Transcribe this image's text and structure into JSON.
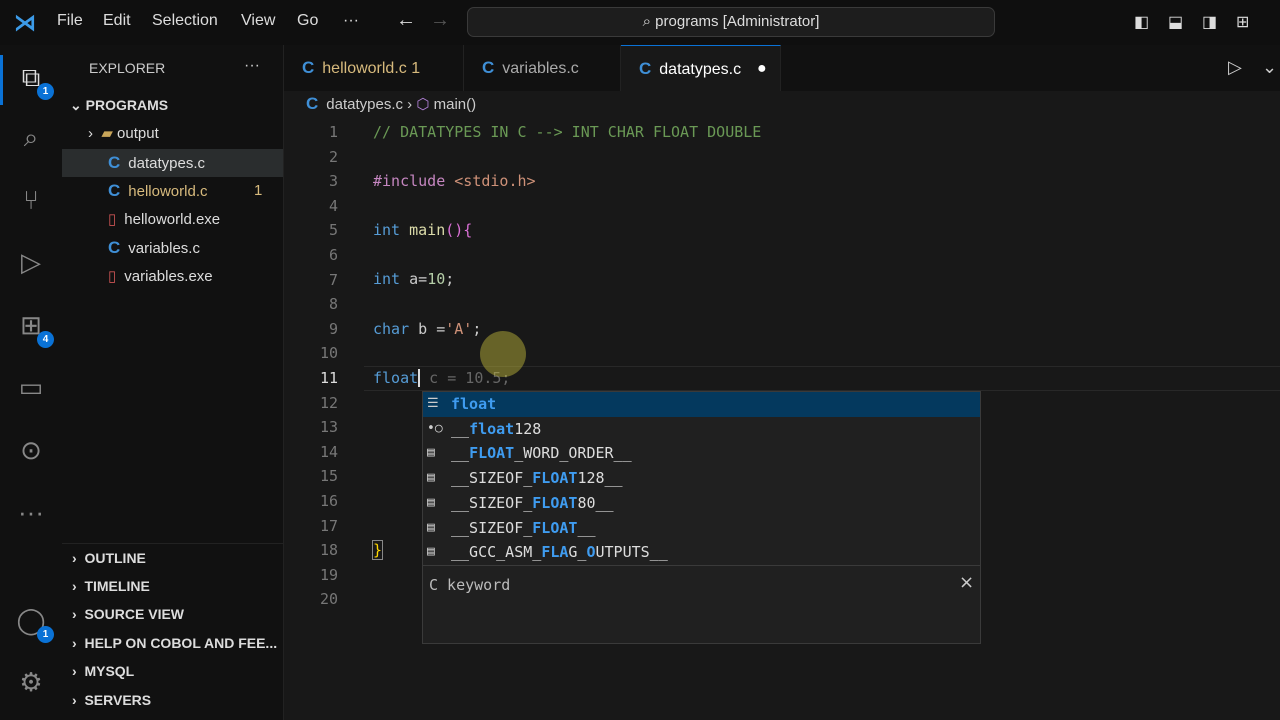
{
  "menu": [
    "File",
    "Edit",
    "Selection",
    "View",
    "Go",
    "···"
  ],
  "search": "programs [Administrator]",
  "activity_badges": {
    "explorer": "1",
    "account": "1",
    "extensions": "4"
  },
  "sidebar": {
    "title": "EXPLORER",
    "more": "···",
    "folder": "PROGRAMS",
    "items": [
      {
        "label": "output",
        "type": "folder"
      },
      {
        "label": "datatypes.c",
        "type": "c"
      },
      {
        "label": "helloworld.c",
        "type": "c",
        "badge": "1"
      },
      {
        "label": "helloworld.exe",
        "type": "exe"
      },
      {
        "label": "variables.c",
        "type": "c"
      },
      {
        "label": "variables.exe",
        "type": "exe"
      }
    ],
    "sections": [
      "OUTLINE",
      "TIMELINE",
      "SOURCE VIEW",
      "HELP ON COBOL AND FEE...",
      "MYSQL",
      "SERVERS"
    ]
  },
  "tabs": [
    {
      "label": "helloworld.c",
      "badge": "1"
    },
    {
      "label": "variables.c"
    },
    {
      "label": "datatypes.c",
      "dirty": "●"
    }
  ],
  "breadcrumb": {
    "file": "datatypes.c",
    "symbol": "main()"
  },
  "editor": {
    "line_numbers": [
      "1",
      "2",
      "3",
      "4",
      "5",
      "6",
      "7",
      "8",
      "9",
      "10",
      "11",
      "12",
      "13",
      "14",
      "15",
      "16",
      "17",
      "18",
      "19",
      "20"
    ],
    "l1": "// DATATYPES IN C --> INT CHAR FLOAT DOUBLE",
    "l3a": "#include ",
    "l3b": "<stdio.h>",
    "l5a": "int ",
    "l5b": "main",
    "l5c": "(){",
    "l7a": "int ",
    "l7b": "a=",
    "l7c": "10",
    "l7d": ";",
    "l9a": "char ",
    "l9b": "b =",
    "l9c": "'A'",
    "l9d": ";",
    "l11a": "float",
    "l11b": " c = 10.5;",
    "l18": "}"
  },
  "suggest": {
    "items": [
      {
        "icon": "keyword",
        "p": [
          "",
          "float",
          ""
        ]
      },
      {
        "icon": "variable",
        "p": [
          "__",
          "float",
          "128"
        ]
      },
      {
        "icon": "text",
        "p": [
          "__",
          "FLOAT",
          "_WORD_ORDER__"
        ]
      },
      {
        "icon": "text",
        "p": [
          "__SIZEOF_",
          "FLOAT",
          "128__"
        ]
      },
      {
        "icon": "text",
        "p": [
          "__SIZEOF_",
          "FLOAT",
          "80__"
        ]
      },
      {
        "icon": "text",
        "p": [
          "__SIZEOF_",
          "FLOAT",
          "__"
        ]
      },
      {
        "icon": "text",
        "p": [
          "__GCC_ASM_",
          "FLA",
          "G_",
          "O",
          "UTPUTS__"
        ]
      }
    ],
    "detail": "C keyword",
    "close": "×"
  }
}
